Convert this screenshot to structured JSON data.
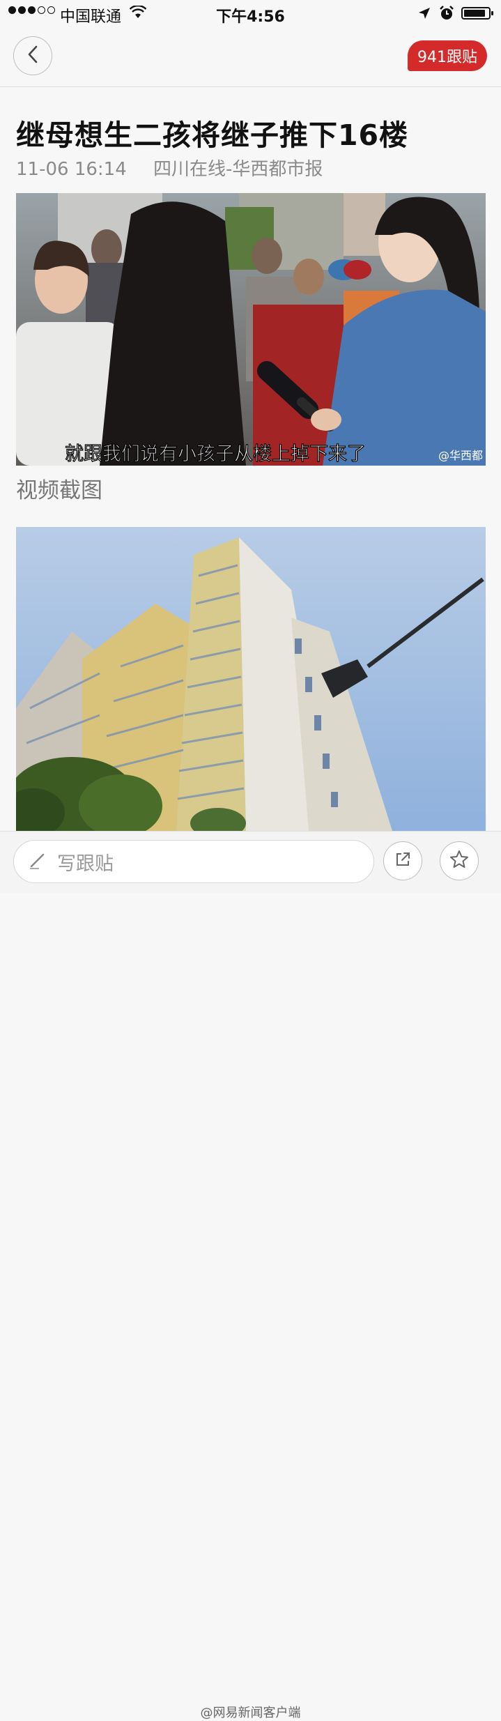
{
  "status": {
    "carrier": "中国联通",
    "time": "下午4:56"
  },
  "nav": {
    "back_icon": "chevron-left-icon",
    "comment_count": "941跟贴"
  },
  "article": {
    "title": "继母想生二孩将继子推下16楼",
    "date": "11-06 16:14",
    "source": "四川在线-华西都市报",
    "image1": {
      "subtitle": "就跟我们说有小孩子从楼上掉下来了",
      "logo": "@华西都"
    },
    "image1_caption": "视频截图"
  },
  "toolbar": {
    "reply_placeholder": "写跟贴",
    "share_icon": "share-icon",
    "favorite_icon": "star-icon"
  },
  "watermark": "@网易新闻客户端",
  "colors": {
    "accent": "#d42a2a"
  }
}
